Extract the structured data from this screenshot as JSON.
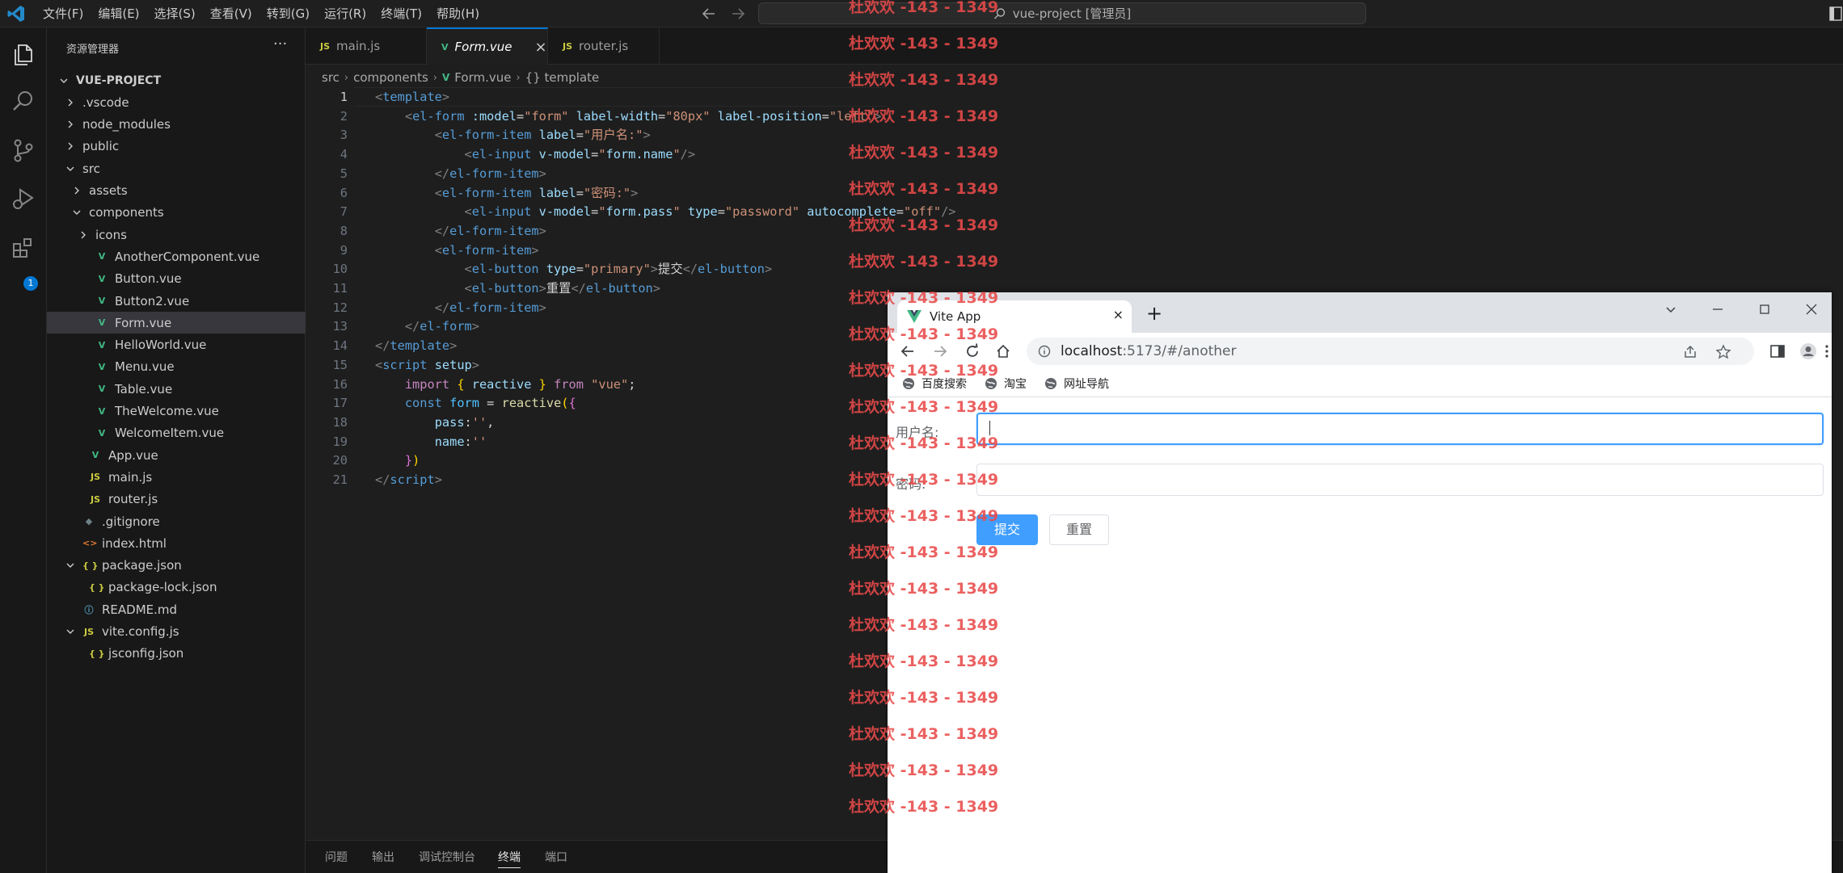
{
  "titlebar": {
    "menus": [
      "文件(F)",
      "编辑(E)",
      "选择(S)",
      "查看(V)",
      "转到(G)",
      "运行(R)",
      "终端(T)",
      "帮助(H)"
    ],
    "command_center": "vue-project [管理员]"
  },
  "activitybar": {
    "extensions_badge": "1"
  },
  "sidebar": {
    "title": "资源管理器",
    "more": "···",
    "tree": [
      {
        "label": "VUE-PROJECT",
        "depth": 0,
        "kind": "folder-open",
        "bold": true
      },
      {
        "label": ".vscode",
        "depth": 1,
        "kind": "folder-closed"
      },
      {
        "label": "node_modules",
        "depth": 1,
        "kind": "folder-closed"
      },
      {
        "label": "public",
        "depth": 1,
        "kind": "folder-closed"
      },
      {
        "label": "src",
        "depth": 1,
        "kind": "folder-open"
      },
      {
        "label": "assets",
        "depth": 2,
        "kind": "folder-closed"
      },
      {
        "label": "components",
        "depth": 2,
        "kind": "folder-open"
      },
      {
        "label": "icons",
        "depth": 3,
        "kind": "folder-closed"
      },
      {
        "label": "AnotherComponent.vue",
        "depth": 3,
        "kind": "vue"
      },
      {
        "label": "Button.vue",
        "depth": 3,
        "kind": "vue"
      },
      {
        "label": "Button2.vue",
        "depth": 3,
        "kind": "vue"
      },
      {
        "label": "Form.vue",
        "depth": 3,
        "kind": "vue",
        "selected": true
      },
      {
        "label": "HelloWorld.vue",
        "depth": 3,
        "kind": "vue"
      },
      {
        "label": "Menu.vue",
        "depth": 3,
        "kind": "vue"
      },
      {
        "label": "Table.vue",
        "depth": 3,
        "kind": "vue"
      },
      {
        "label": "TheWelcome.vue",
        "depth": 3,
        "kind": "vue"
      },
      {
        "label": "WelcomeItem.vue",
        "depth": 3,
        "kind": "vue"
      },
      {
        "label": "App.vue",
        "depth": 2,
        "kind": "vue"
      },
      {
        "label": "main.js",
        "depth": 2,
        "kind": "js"
      },
      {
        "label": "router.js",
        "depth": 2,
        "kind": "js"
      },
      {
        "label": ".gitignore",
        "depth": 1,
        "kind": "git"
      },
      {
        "label": "index.html",
        "depth": 1,
        "kind": "html"
      },
      {
        "label": "package.json",
        "depth": 1,
        "kind": "json-open"
      },
      {
        "label": "package-lock.json",
        "depth": 2,
        "kind": "json"
      },
      {
        "label": "README.md",
        "depth": 1,
        "kind": "md"
      },
      {
        "label": "vite.config.js",
        "depth": 1,
        "kind": "js-open"
      },
      {
        "label": "jsconfig.json",
        "depth": 2,
        "kind": "json"
      }
    ]
  },
  "editor": {
    "tabs": [
      {
        "label": "main.js",
        "icon": "JS",
        "active": false
      },
      {
        "label": "Form.vue",
        "icon": "V",
        "active": true,
        "close": "×"
      },
      {
        "label": "router.js",
        "icon": "JS",
        "active": false
      }
    ],
    "breadcrumb": [
      "src",
      "components",
      "Form.vue",
      "{} template"
    ],
    "current_line": 1,
    "lines": [
      [
        [
          "t-bracket",
          "<"
        ],
        [
          "t-tag",
          "template"
        ],
        [
          "t-bracket",
          ">"
        ]
      ],
      [
        [
          "t-plain",
          "    "
        ],
        [
          "t-bracket",
          "<"
        ],
        [
          "t-tag",
          "el-form"
        ],
        [
          "t-plain",
          " "
        ],
        [
          "t-attr",
          ":model"
        ],
        [
          "t-plain",
          "="
        ],
        [
          "t-str",
          "\"form\""
        ],
        [
          "t-plain",
          " "
        ],
        [
          "t-attr",
          "label-width"
        ],
        [
          "t-plain",
          "="
        ],
        [
          "t-str",
          "\"80px\""
        ],
        [
          "t-plain",
          " "
        ],
        [
          "t-attr",
          "label-position"
        ],
        [
          "t-plain",
          "="
        ],
        [
          "t-str",
          "\"left\""
        ],
        [
          "t-bracket",
          ">"
        ]
      ],
      [
        [
          "t-plain",
          "        "
        ],
        [
          "t-bracket",
          "<"
        ],
        [
          "t-tag",
          "el-form-item"
        ],
        [
          "t-plain",
          " "
        ],
        [
          "t-attr",
          "label"
        ],
        [
          "t-plain",
          "="
        ],
        [
          "t-str",
          "\"用户名:\""
        ],
        [
          "t-bracket",
          ">"
        ]
      ],
      [
        [
          "t-plain",
          "            "
        ],
        [
          "t-bracket",
          "<"
        ],
        [
          "t-tag",
          "el-input"
        ],
        [
          "t-plain",
          " "
        ],
        [
          "t-attr",
          "v-model"
        ],
        [
          "t-plain",
          "="
        ],
        [
          "t-str",
          "\""
        ],
        [
          "t-attr",
          "form.name"
        ],
        [
          "t-str",
          "\""
        ],
        [
          "t-bracket",
          "/>"
        ]
      ],
      [
        [
          "t-plain",
          "        "
        ],
        [
          "t-bracket",
          "</"
        ],
        [
          "t-tag",
          "el-form-item"
        ],
        [
          "t-bracket",
          ">"
        ]
      ],
      [
        [
          "t-plain",
          "        "
        ],
        [
          "t-bracket",
          "<"
        ],
        [
          "t-tag",
          "el-form-item"
        ],
        [
          "t-plain",
          " "
        ],
        [
          "t-attr",
          "label"
        ],
        [
          "t-plain",
          "="
        ],
        [
          "t-str",
          "\"密码:\""
        ],
        [
          "t-bracket",
          ">"
        ]
      ],
      [
        [
          "t-plain",
          "            "
        ],
        [
          "t-bracket",
          "<"
        ],
        [
          "t-tag",
          "el-input"
        ],
        [
          "t-plain",
          " "
        ],
        [
          "t-attr",
          "v-model"
        ],
        [
          "t-plain",
          "="
        ],
        [
          "t-str",
          "\""
        ],
        [
          "t-attr",
          "form.pass"
        ],
        [
          "t-str",
          "\""
        ],
        [
          "t-plain",
          " "
        ],
        [
          "t-attr",
          "type"
        ],
        [
          "t-plain",
          "="
        ],
        [
          "t-str",
          "\"password\""
        ],
        [
          "t-plain",
          " "
        ],
        [
          "t-attr",
          "autocomplete"
        ],
        [
          "t-plain",
          "="
        ],
        [
          "t-str",
          "\"off\""
        ],
        [
          "t-bracket",
          "/>"
        ]
      ],
      [
        [
          "t-plain",
          "        "
        ],
        [
          "t-bracket",
          "</"
        ],
        [
          "t-tag",
          "el-form-item"
        ],
        [
          "t-bracket",
          ">"
        ]
      ],
      [
        [
          "t-plain",
          "        "
        ],
        [
          "t-bracket",
          "<"
        ],
        [
          "t-tag",
          "el-form-item"
        ],
        [
          "t-bracket",
          ">"
        ]
      ],
      [
        [
          "t-plain",
          "            "
        ],
        [
          "t-bracket",
          "<"
        ],
        [
          "t-tag",
          "el-button"
        ],
        [
          "t-plain",
          " "
        ],
        [
          "t-attr",
          "type"
        ],
        [
          "t-plain",
          "="
        ],
        [
          "t-str",
          "\"primary\""
        ],
        [
          "t-bracket",
          ">"
        ],
        [
          "t-text",
          "提交"
        ],
        [
          "t-bracket",
          "</"
        ],
        [
          "t-tag",
          "el-button"
        ],
        [
          "t-bracket",
          ">"
        ]
      ],
      [
        [
          "t-plain",
          "            "
        ],
        [
          "t-bracket",
          "<"
        ],
        [
          "t-tag",
          "el-button"
        ],
        [
          "t-bracket",
          ">"
        ],
        [
          "t-text",
          "重置"
        ],
        [
          "t-bracket",
          "</"
        ],
        [
          "t-tag",
          "el-button"
        ],
        [
          "t-bracket",
          ">"
        ]
      ],
      [
        [
          "t-plain",
          "        "
        ],
        [
          "t-bracket",
          "</"
        ],
        [
          "t-tag",
          "el-form-item"
        ],
        [
          "t-bracket",
          ">"
        ]
      ],
      [
        [
          "t-plain",
          "    "
        ],
        [
          "t-bracket",
          "</"
        ],
        [
          "t-tag",
          "el-form"
        ],
        [
          "t-bracket",
          ">"
        ]
      ],
      [
        [
          "t-bracket",
          "</"
        ],
        [
          "t-tag",
          "template"
        ],
        [
          "t-bracket",
          ">"
        ]
      ],
      [
        [
          "t-bracket",
          "<"
        ],
        [
          "t-tag",
          "script"
        ],
        [
          "t-plain",
          " "
        ],
        [
          "t-attr",
          "setup"
        ],
        [
          "t-bracket",
          ">"
        ]
      ],
      [
        [
          "t-plain",
          "    "
        ],
        [
          "t-kw",
          "import"
        ],
        [
          "t-plain",
          " "
        ],
        [
          "t-brace",
          "{"
        ],
        [
          "t-plain",
          " "
        ],
        [
          "t-attr",
          "reactive"
        ],
        [
          "t-plain",
          " "
        ],
        [
          "t-brace",
          "}"
        ],
        [
          "t-plain",
          " "
        ],
        [
          "t-kw",
          "from"
        ],
        [
          "t-plain",
          " "
        ],
        [
          "t-str",
          "\"vue\""
        ],
        [
          "t-plain",
          ";"
        ]
      ],
      [
        [
          "t-plain",
          "    "
        ],
        [
          "t-kw2",
          "const"
        ],
        [
          "t-plain",
          " "
        ],
        [
          "t-var",
          "form"
        ],
        [
          "t-plain",
          " = "
        ],
        [
          "t-fn",
          "reactive"
        ],
        [
          "t-brace",
          "("
        ],
        [
          "t-brace2",
          "{"
        ]
      ],
      [
        [
          "t-plain",
          "        "
        ],
        [
          "t-attr",
          "pass"
        ],
        [
          "t-plain",
          ":"
        ],
        [
          "t-str",
          "''"
        ],
        [
          "t-plain",
          ","
        ]
      ],
      [
        [
          "t-plain",
          "        "
        ],
        [
          "t-attr",
          "name"
        ],
        [
          "t-plain",
          ":"
        ],
        [
          "t-str",
          "''"
        ]
      ],
      [
        [
          "t-plain",
          "    "
        ],
        [
          "t-brace2",
          "}"
        ],
        [
          "t-brace",
          ")"
        ]
      ],
      [
        [
          "t-bracket",
          "</"
        ],
        [
          "t-tag",
          "script"
        ],
        [
          "t-bracket",
          ">"
        ]
      ]
    ]
  },
  "panel": {
    "tabs": [
      "问题",
      "输出",
      "调试控制台",
      "终端",
      "端口"
    ],
    "active": "终端"
  },
  "browser": {
    "tab_title": "Vite App",
    "tab_close": "×",
    "new_tab": "+",
    "url_host": "localhost",
    "url_rest": ":5173/#/another",
    "bookmarks": [
      "百度搜索",
      "淘宝",
      "网址导航"
    ],
    "page": {
      "username_label": "用户名:",
      "password_label": "密码:",
      "username_value": "",
      "password_value": "",
      "submit_label": "提交",
      "reset_label": "重置"
    }
  },
  "watermark": {
    "text": "杜欢欢 -143 - 1349",
    "count": 23
  },
  "colors": {
    "accent": "#0078d4",
    "vue_green": "#41b883",
    "primary_button": "#409eff",
    "watermark": "#e84a4a"
  }
}
